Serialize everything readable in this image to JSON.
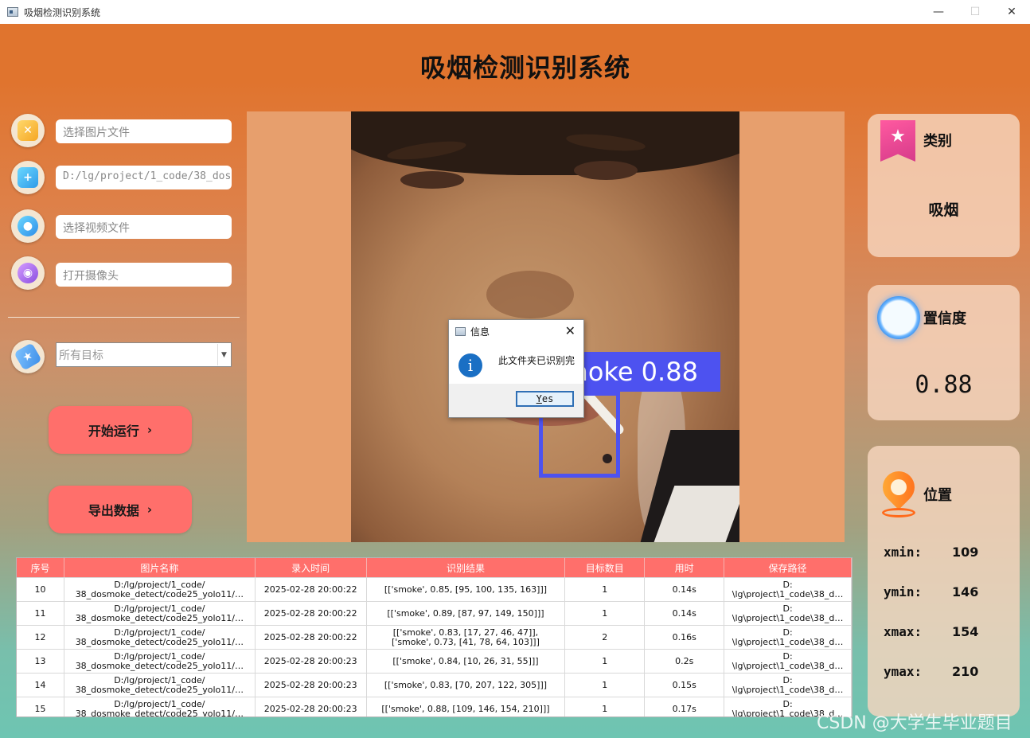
{
  "window": {
    "title": "吸烟检测识别系统",
    "minimize": "—",
    "maximize": "☐",
    "close": "✕"
  },
  "app_title": "吸烟检测识别系统",
  "controls": {
    "image_file": "选择图片文件",
    "folder_path": "D:/lg/project/1_code/38_dos",
    "video_file": "选择视频文件",
    "camera": "打开摄像头",
    "target_select": "所有目标"
  },
  "buttons": {
    "start": "开始运行",
    "export": "导出数据",
    "chevron": "›"
  },
  "detection": {
    "label": "smoke 0.88"
  },
  "dialog": {
    "title": "信息",
    "message": "此文件夹已识别完",
    "yes": "Yes"
  },
  "cards": {
    "category_label": "类别",
    "category_value": "吸烟",
    "confidence_label": "置信度",
    "confidence_value": "0.88",
    "position_label": "位置",
    "xmin_label": "xmin:",
    "xmin": "109",
    "ymin_label": "ymin:",
    "ymin": "146",
    "xmax_label": "xmax:",
    "xmax": "154",
    "ymax_label": "ymax:",
    "ymax": "210"
  },
  "table": {
    "headers": [
      "序号",
      "图片名称",
      "录入时间",
      "识别结果",
      "目标数目",
      "用时",
      "保存路径"
    ],
    "rows": [
      [
        "10",
        "D:/lg/project/1_code/\n38_dosmoke_detect/code25_yolo11/…",
        "2025-02-28 20:00:22",
        "[['smoke', 0.85, [95, 100, 135, 163]]]",
        "1",
        "0.14s",
        "D:\n\\lg\\project\\1_code\\38_d…"
      ],
      [
        "11",
        "D:/lg/project/1_code/\n38_dosmoke_detect/code25_yolo11/…",
        "2025-02-28 20:00:22",
        "[['smoke', 0.89, [87, 97, 149, 150]]]",
        "1",
        "0.14s",
        "D:\n\\lg\\project\\1_code\\38_d…"
      ],
      [
        "12",
        "D:/lg/project/1_code/\n38_dosmoke_detect/code25_yolo11/…",
        "2025-02-28 20:00:22",
        "[['smoke', 0.83, [17, 27, 46, 47]],\n['smoke', 0.73, [41, 78, 64, 103]]]",
        "2",
        "0.16s",
        "D:\n\\lg\\project\\1_code\\38_d…"
      ],
      [
        "13",
        "D:/lg/project/1_code/\n38_dosmoke_detect/code25_yolo11/…",
        "2025-02-28 20:00:23",
        "[['smoke', 0.84, [10, 26, 31, 55]]]",
        "1",
        "0.2s",
        "D:\n\\lg\\project\\1_code\\38_d…"
      ],
      [
        "14",
        "D:/lg/project/1_code/\n38_dosmoke_detect/code25_yolo11/…",
        "2025-02-28 20:00:23",
        "[['smoke', 0.83, [70, 207, 122, 305]]]",
        "1",
        "0.15s",
        "D:\n\\lg\\project\\1_code\\38_d…"
      ],
      [
        "15",
        "D:/lg/project/1_code/\n38_dosmoke_detect/code25_yolo11/…",
        "2025-02-28 20:00:23",
        "[['smoke', 0.88, [109, 146, 154, 210]]]",
        "1",
        "0.17s",
        "D:\n\\lg\\project\\1_code\\38_d…"
      ]
    ]
  },
  "watermark": "CSDN @大学生毕业题目",
  "colors": {
    "accent_button": "#ff6f6b",
    "bbox": "#4d52f0",
    "header_orange": "#e0742e",
    "footer_teal": "#6ec5b2"
  },
  "icons": [
    "image-file-icon",
    "folder-icon",
    "video-icon",
    "camera-icon",
    "target-tag-icon",
    "category-star-icon",
    "confidence-ring-icon",
    "location-pin-icon",
    "info-icon"
  ]
}
